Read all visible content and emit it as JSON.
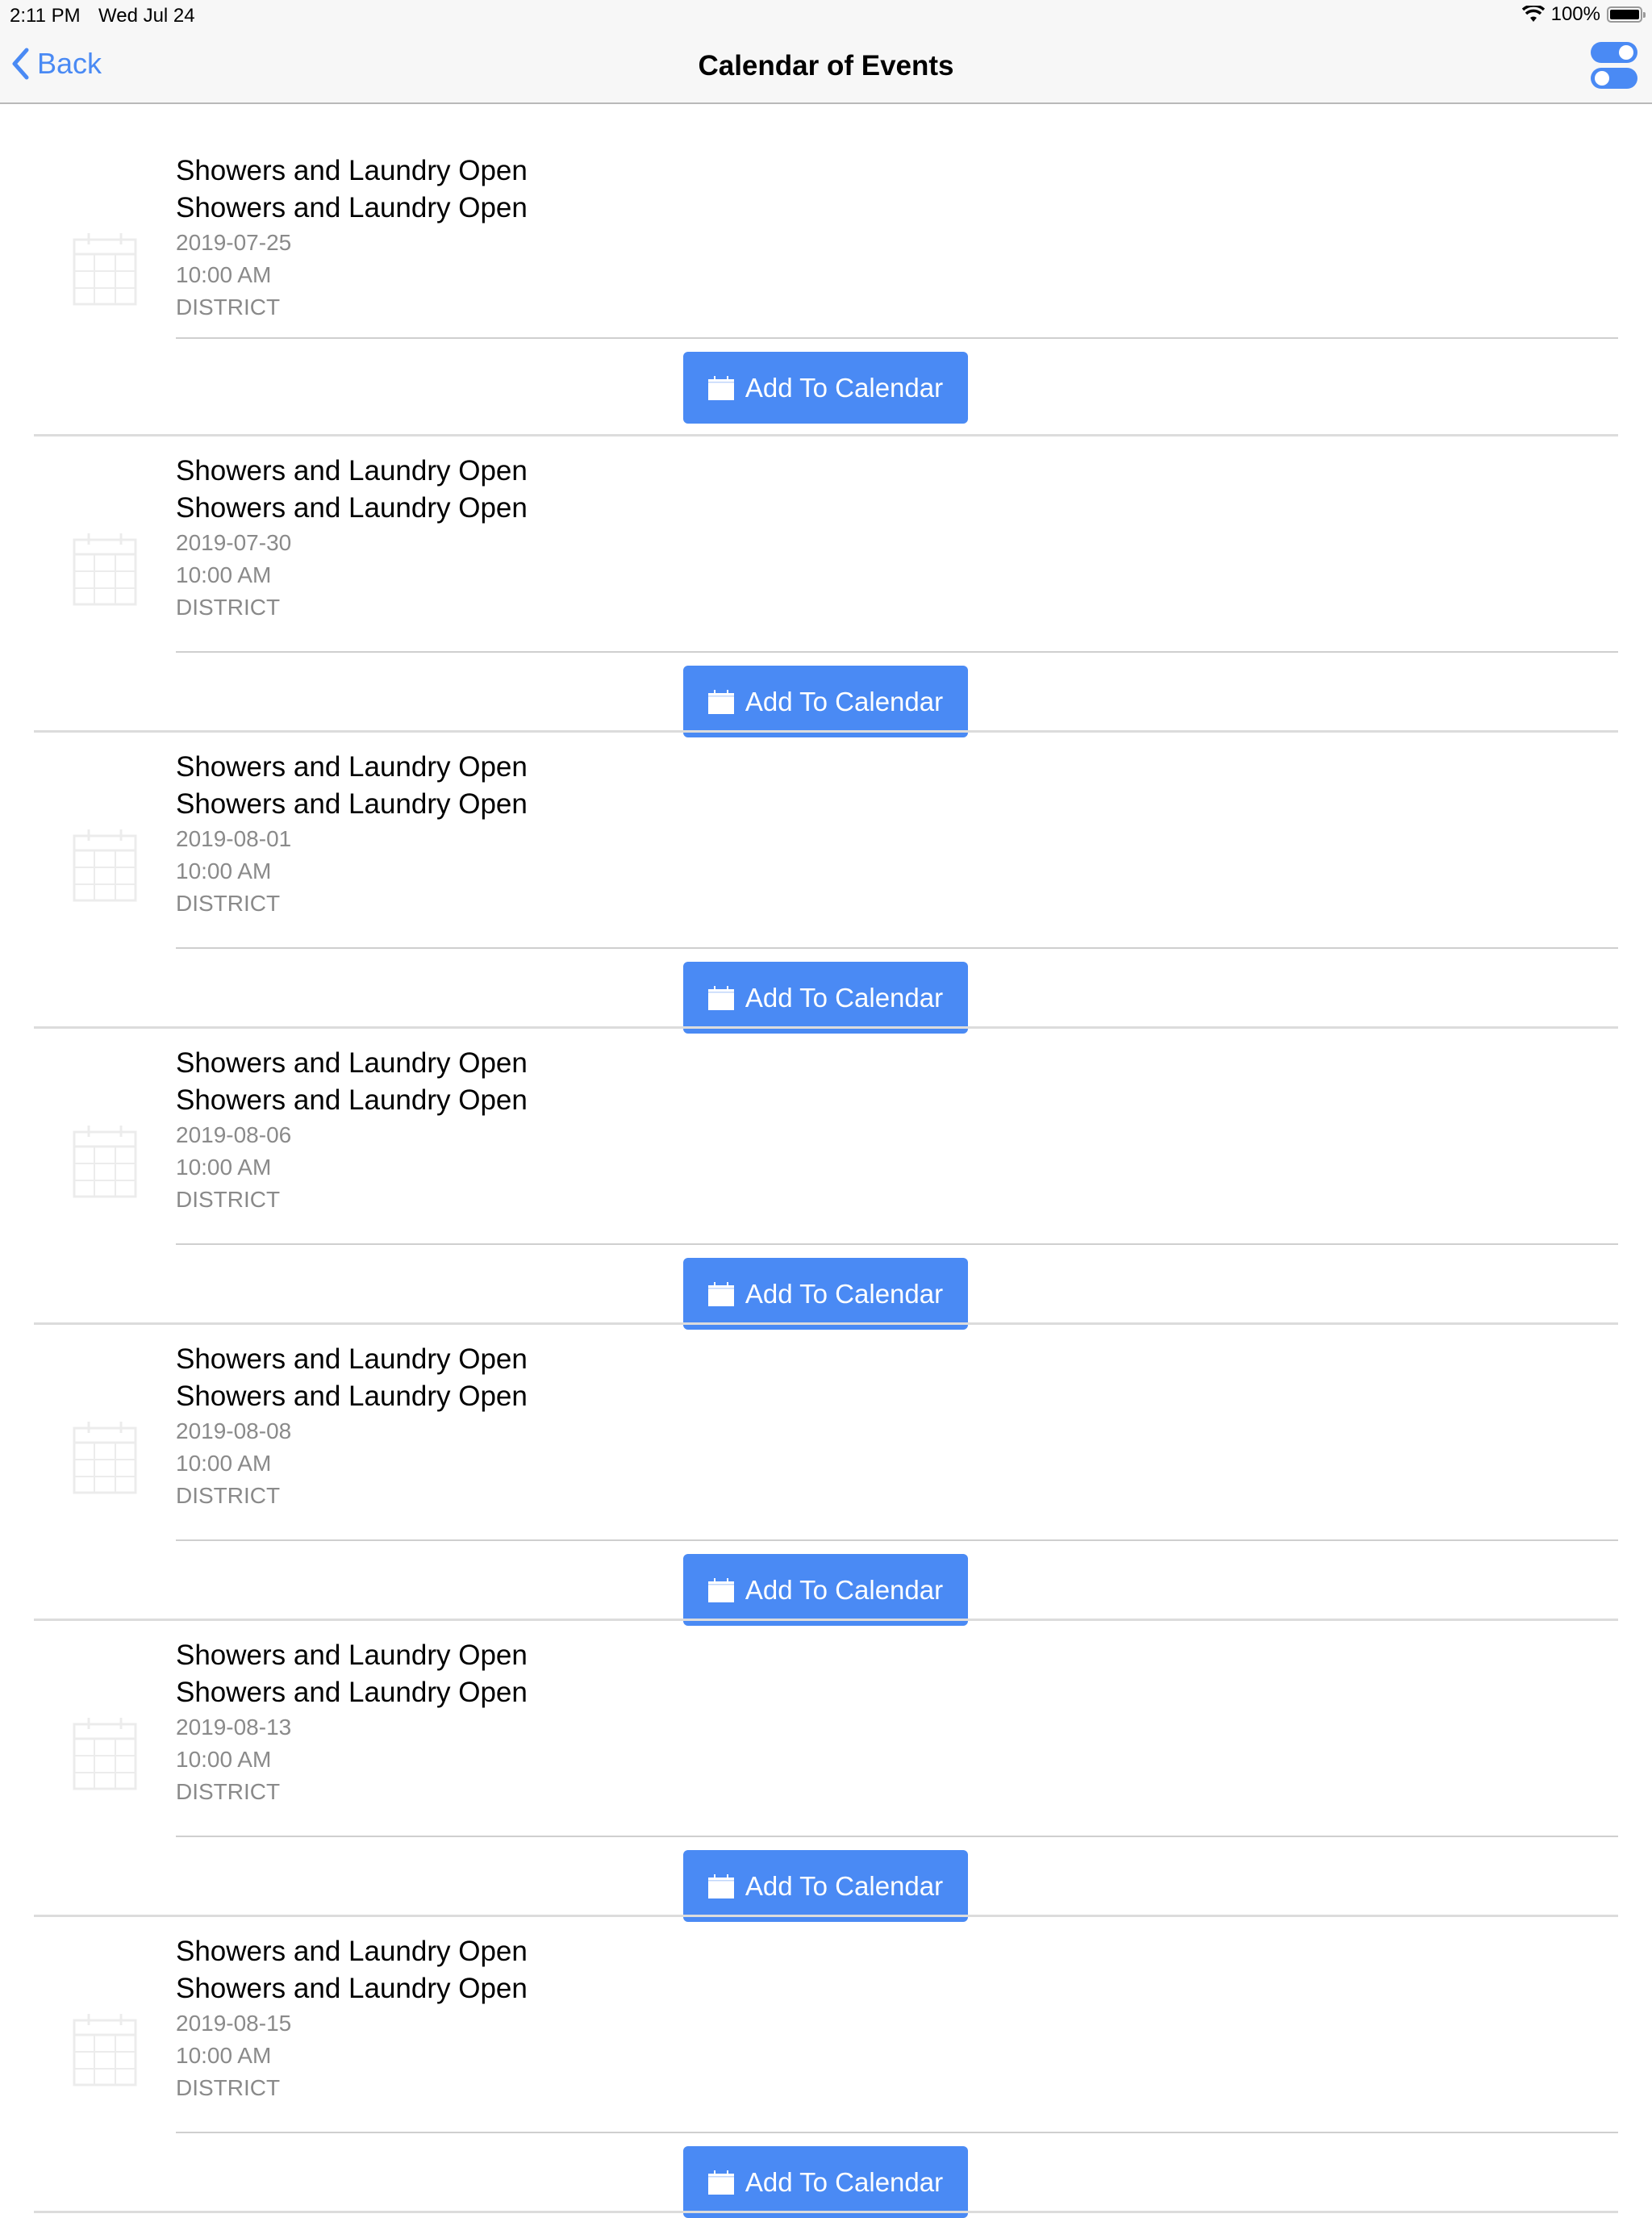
{
  "status_bar": {
    "time": "2:11 PM",
    "date": "Wed Jul 24",
    "battery": "100%",
    "wifi_icon": "wifi-icon",
    "battery_icon": "battery-icon"
  },
  "nav": {
    "back_label": "Back",
    "title": "Calendar of Events",
    "right_icon": "toggle-settings-icon"
  },
  "accent_color": "#4a8af4",
  "events": [
    {
      "title": "Showers and Laundry Open",
      "subtitle": "Showers and Laundry Open",
      "date": "2019-07-25",
      "time": "10:00 AM",
      "location": "DISTRICT",
      "button_label": "Add To Calendar"
    },
    {
      "title": "Showers and Laundry Open",
      "subtitle": "Showers and Laundry Open",
      "date": "2019-07-30",
      "time": "10:00 AM",
      "location": "DISTRICT",
      "button_label": "Add To Calendar"
    },
    {
      "title": "Showers and Laundry Open",
      "subtitle": "Showers and Laundry Open",
      "date": "2019-08-01",
      "time": "10:00 AM",
      "location": "DISTRICT",
      "button_label": "Add To Calendar"
    },
    {
      "title": "Showers and Laundry Open",
      "subtitle": "Showers and Laundry Open",
      "date": "2019-08-06",
      "time": "10:00 AM",
      "location": "DISTRICT",
      "button_label": "Add To Calendar"
    },
    {
      "title": "Showers and Laundry Open",
      "subtitle": "Showers and Laundry Open",
      "date": "2019-08-08",
      "time": "10:00 AM",
      "location": "DISTRICT",
      "button_label": "Add To Calendar"
    },
    {
      "title": "Showers and Laundry Open",
      "subtitle": "Showers and Laundry Open",
      "date": "2019-08-13",
      "time": "10:00 AM",
      "location": "DISTRICT",
      "button_label": "Add To Calendar"
    },
    {
      "title": "Showers and Laundry Open",
      "subtitle": "Showers and Laundry Open",
      "date": "2019-08-15",
      "time": "10:00 AM",
      "location": "DISTRICT",
      "button_label": "Add To Calendar"
    }
  ]
}
